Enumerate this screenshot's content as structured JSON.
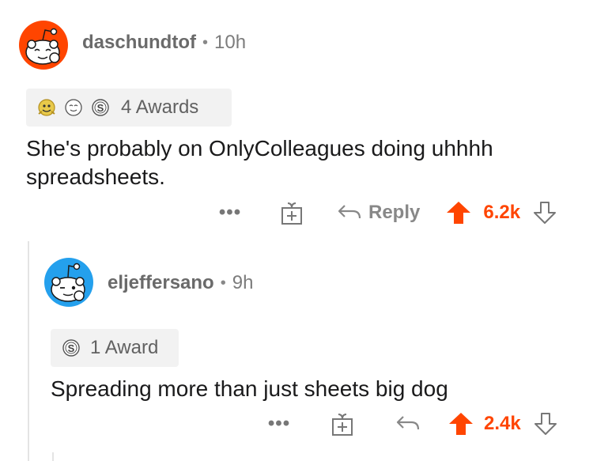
{
  "comments": [
    {
      "username": "daschundtof",
      "separator": "•",
      "age": "10h",
      "awards_label": "4 Awards",
      "body": "She's probably on OnlyColleagues doing uhhhh spreadsheets.",
      "more_label": "•••",
      "reply_label": "Reply",
      "score": "6.2k",
      "avatar_color": "#ff4500"
    },
    {
      "username": "eljeffersano",
      "separator": "•",
      "age": "9h",
      "awards_label": "1 Award",
      "body": "Spreading more than just sheets big dog",
      "more_label": "•••",
      "score": "2.4k",
      "avatar_color": "#24a0ed"
    }
  ],
  "colors": {
    "upvote": "#ff4500",
    "muted": "#888888",
    "award_bg": "#f2f2f2"
  }
}
